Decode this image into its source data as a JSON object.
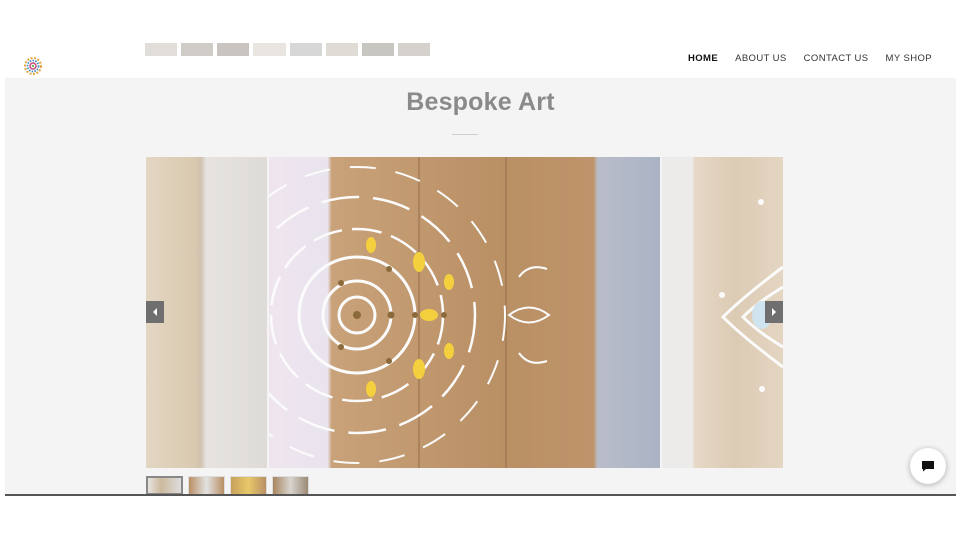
{
  "header": {
    "logo_icon": "mandala-logo-icon",
    "nav": [
      {
        "label": "HOME",
        "active": true
      },
      {
        "label": "ABOUT US",
        "active": false
      },
      {
        "label": "CONTACT US",
        "active": false
      },
      {
        "label": "MY SHOP",
        "active": false
      }
    ]
  },
  "main": {
    "title": "Bespoke Art",
    "title_color": "#8a8a8a",
    "background": "#f4f4f4"
  },
  "slider": {
    "prev_icon": "chevron-left-icon",
    "next_icon": "chevron-right-icon",
    "thumbnail_count": 4,
    "selected_thumbnail": 1
  },
  "chat": {
    "icon": "chat-bubble-icon"
  }
}
